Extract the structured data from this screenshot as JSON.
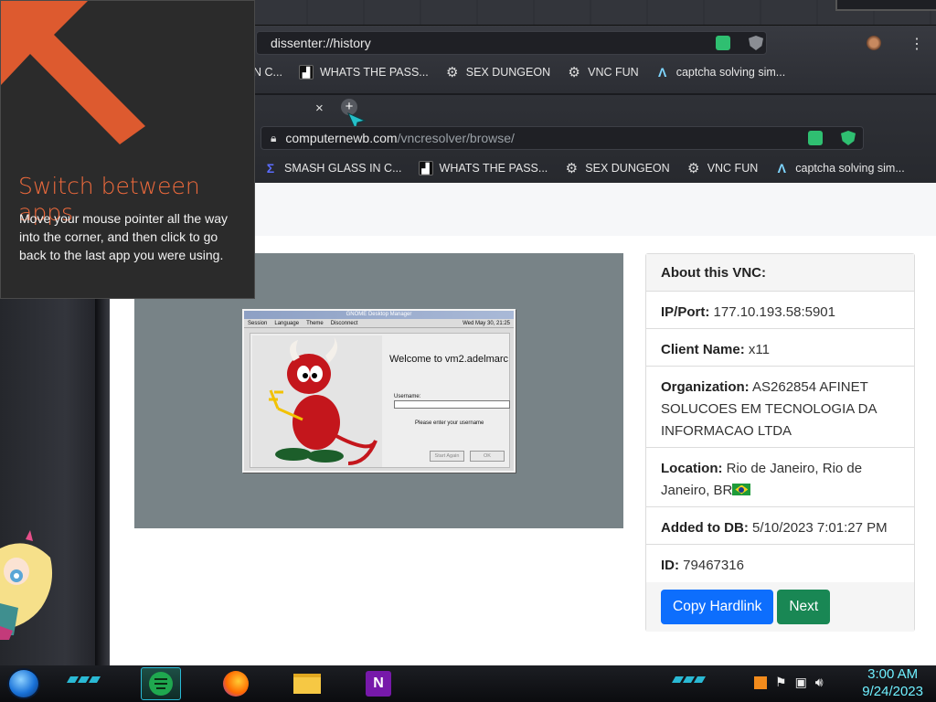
{
  "back_window": {
    "url": "dissenter://history",
    "bookmark_cut": "N C...",
    "bookmarks": [
      {
        "label": "WHATS THE PASS...",
        "icon": "dark-square-icon"
      },
      {
        "label": "SEX DUNGEON",
        "icon": "gear-icon"
      },
      {
        "label": "VNC FUN",
        "icon": "gear-icon"
      },
      {
        "label": "captcha solving sim...",
        "icon": "a-logo-icon"
      }
    ]
  },
  "front_window": {
    "tab_close": "×",
    "new_tab": "+",
    "url_host": "computernewb.com",
    "url_path": "/vncresolver/browse/",
    "bookmarks": [
      {
        "label": "SMASH GLASS IN C...",
        "icon": "z-logo-icon"
      },
      {
        "label": "WHATS THE PASS...",
        "icon": "dark-square-icon"
      },
      {
        "label": "SEX DUNGEON",
        "icon": "gear-icon"
      },
      {
        "label": "VNC FUN",
        "icon": "gear-icon"
      },
      {
        "label": "captcha solving sim...",
        "icon": "a-logo-icon"
      }
    ]
  },
  "vnc_screenshot": {
    "title": "GNOME Desktop Manager",
    "menu": [
      "Session",
      "Language",
      "Theme",
      "Disconnect"
    ],
    "date": "Wed May 30, 21:25",
    "welcome": "Welcome to vm2.adelmarc",
    "username_label": "Username:",
    "hint": "Please enter your username",
    "start_again": "Start Again",
    "ok": "OK"
  },
  "about": {
    "header": "About this VNC:",
    "ip_label": "IP/Port:",
    "ip_value": "177.10.193.58:5901",
    "client_label": "Client Name:",
    "client_value": "x11",
    "org_label": "Organization:",
    "org_value": "AS262854 AFINET SOLUCOES EM TECNOLOGIA DA INFORMACAO LTDA",
    "location_label": "Location:",
    "location_value": "Rio de Janeiro, Rio de Janeiro, BR",
    "added_label": "Added to DB:",
    "added_value": "5/10/2023 7:01:27 PM",
    "id_label": "ID:",
    "id_value": "79467316",
    "copy_button": "Copy Hardlink",
    "next_button": "Next"
  },
  "hot_corner_tip": {
    "title": "Switch between apps",
    "body": "Move your mouse pointer all the way into the corner, and then click to go back to the last app you were using."
  },
  "taskbar": {
    "time": "3:00 AM",
    "date": "9/24/2023",
    "apps": [
      "sticky-notes-icon",
      "firefox-icon",
      "file-explorer-icon",
      "onenote-icon"
    ],
    "tray": [
      "tray-app-icon",
      "flag-icon",
      "network-icon",
      "volume-icon"
    ]
  },
  "colors": {
    "tip_title": "#ee6a3c",
    "copy_button": "#0d6efd",
    "next_button": "#198754",
    "clock": "#6ff0ff"
  }
}
